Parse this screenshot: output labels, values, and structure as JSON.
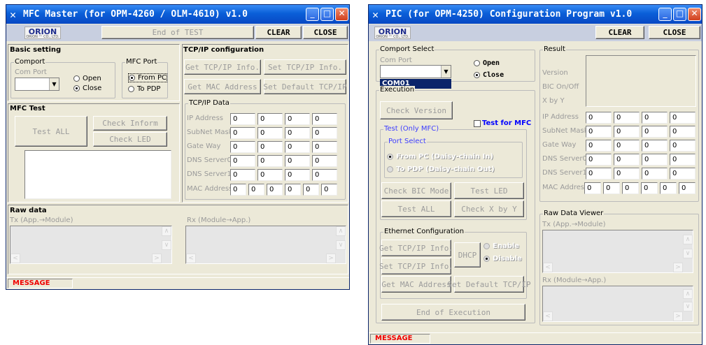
{
  "mfc": {
    "title": "MFC Master (for OPM-4260 / OLM-4610) v1.0",
    "logo": "ORION",
    "logo_sub": "ORION ™ CO., LTD.",
    "status_field": "End of TEST",
    "clear": "CLEAR",
    "close": "CLOSE",
    "basic_title": "Basic setting",
    "comport_group": "Comport",
    "com_port_label": "Com Port",
    "open_label": "Open",
    "close_label": "Close",
    "mfcport_group": "MFC Port",
    "from_pc": "From PC",
    "to_pdp": "To PDP",
    "tcp_title": "TCP/IP configuration",
    "get_tcp": "Get TCP/IP Info.",
    "set_tcp": "Set TCP/IP Info.",
    "get_mac": "Get MAC Address",
    "set_default": "Set Default TCP/IP",
    "tcp_data_group": "TCP/IP Data",
    "ip_label": "IP Address",
    "subnet_label": "SubNet Mask",
    "gateway_label": "Gate Way",
    "dns0_label": "DNS Server0",
    "dns1_label": "DNS Server1",
    "mac_label": "MAC Address",
    "zero": "0",
    "mfc_test_title": "MFC Test",
    "test_all": "Test ALL",
    "check_inform": "Check Inform",
    "check_led": "Check LED",
    "raw_title": "Raw data",
    "tx_label": "Tx (App.→Module)",
    "rx_label": "Rx (Module→App.)",
    "message": "MESSAGE"
  },
  "pic": {
    "title": "PIC (for OPM-4250) Configuration Program v1.0",
    "logo": "ORION",
    "logo_sub": "ORION ™ CO., LTD.",
    "clear": "CLEAR",
    "close": "CLOSE",
    "comport_group": "Comport Select",
    "com_port_label": "Com Port",
    "open_label": "Open",
    "close_label": "Close",
    "com_option": "COM01",
    "execution_group": "Execution",
    "check_version": "Check Version",
    "test_for_mfc": "Test for MFC",
    "test_only_group": "Test (Only MFC)",
    "port_select_group": "Port Select",
    "from_pc_daisy": "From PC (Daisy-chain In)",
    "to_pdp_daisy": "To PDP (Daisy-chain Out)",
    "check_bic": "Check BIC Mode",
    "test_led": "Test LED",
    "test_all": "Test ALL",
    "check_xy": "Check X by Y",
    "eth_group": "Ethernet Configuration",
    "get_tcp": "Get TCP/IP Info.",
    "set_tcp": "Set TCP/IP Info.",
    "dhcp": "DHCP",
    "enable": "Enable",
    "disable": "Disable",
    "get_mac": "Get MAC Address",
    "set_default": "Set Default TCP/IP",
    "end_exec": "End of Execution",
    "result_group": "Result",
    "version_label": "Version",
    "bic_label": "BIC On/Off",
    "xy_label": "X by Y",
    "ip_label": "IP Address",
    "subnet_label": "SubNet Mask",
    "gateway_label": "Gate Way",
    "dns0_label": "DNS Server0",
    "dns1_label": "DNS Server1",
    "mac_label": "MAC Address",
    "zero": "0",
    "raw_group": "Raw Data Viewer",
    "tx_label": "Tx (App.→Module)",
    "rx_label": "Rx (Module→App.)",
    "message": "MESSAGE"
  },
  "colors": {
    "title_bar": "#0a5fd8",
    "message": "#e00000",
    "link_blue": "#3d3dff"
  },
  "icons": {
    "app": "tools-icon",
    "min": "minimize-icon",
    "max": "maximize-icon",
    "close": "close-icon"
  }
}
